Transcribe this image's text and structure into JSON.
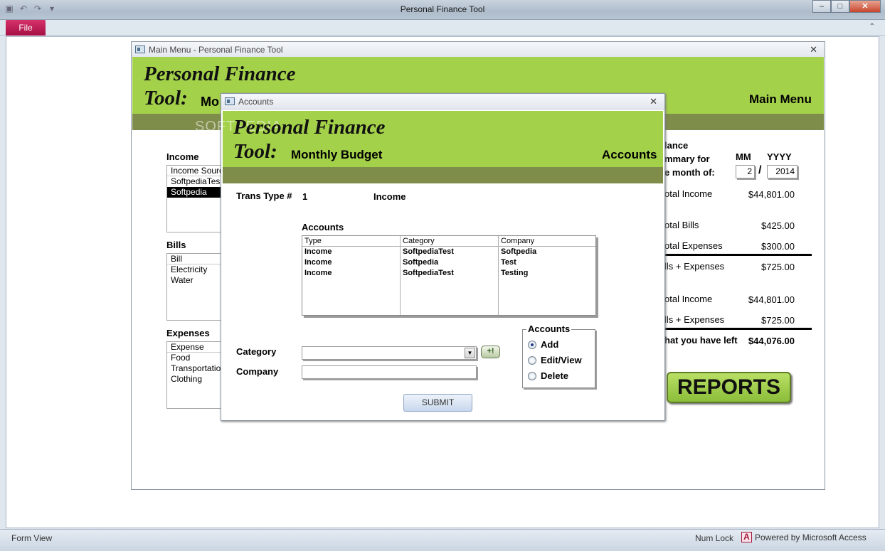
{
  "app": {
    "title": "Personal Finance Tool",
    "file_tab": "File",
    "watermark": "SOFTPEDIA"
  },
  "main_form": {
    "window_title": "Main Menu - Personal Finance Tool",
    "banner_line1": "Personal Finance",
    "banner_line2": "Tool:",
    "banner_subtitle": "Mo",
    "banner_right": "Main Menu",
    "income": {
      "heading": "Income",
      "rows": [
        "Income Sourc",
        "SoftpediaTes",
        "Softpedia"
      ],
      "selected_index": 2
    },
    "bills": {
      "heading": "Bills",
      "rows": [
        "Bill",
        "Electricity",
        "Water"
      ]
    },
    "expenses": {
      "heading": "Expenses",
      "rows": [
        "Expense",
        "Food",
        "Transportatio",
        "Clothing"
      ]
    },
    "summary": {
      "heading_line1": "lance",
      "heading_line2": "mmary for",
      "heading_line3": "e month of:",
      "mm_label": "MM",
      "yyyy_label": "YYYY",
      "mm_value": "2",
      "slash": "/",
      "yyyy_value": "2014",
      "total_income_label": "otal Income",
      "total_income_value": "$44,801.00",
      "total_bills_label": "otal Bills",
      "total_bills_value": "$425.00",
      "total_expenses_label": "otal Expenses",
      "total_expenses_value": "$300.00",
      "bills_expenses_label": "lls + Expenses",
      "bills_expenses_value": "$725.00",
      "total_income_label2": "otal Income",
      "total_income_value2": "$44,801.00",
      "bills_expenses_label2": "lls + Expenses",
      "bills_expenses_value2": "$725.00",
      "left_label": "hat you have left",
      "left_value": "$44,076.00"
    },
    "reports_label": "REPORTS"
  },
  "accounts_form": {
    "window_title": "Accounts",
    "banner_line1": "Personal Finance",
    "banner_line2": "Tool:",
    "banner_subtitle": "Monthly Budget",
    "banner_right": "Accounts",
    "trans_type_label": "Trans Type #",
    "trans_type_value": "1",
    "trans_type_name": "Income",
    "accounts_heading": "Accounts",
    "table": {
      "headers": [
        "Type",
        "Category",
        "Company"
      ],
      "rows": [
        [
          "Income",
          "SoftpediaTest",
          "Softpedia"
        ],
        [
          "Income",
          "Softpedia",
          "Test"
        ],
        [
          "Income",
          "SoftpediaTest",
          "Testing"
        ]
      ]
    },
    "category_label": "Category",
    "category_value": "",
    "company_label": "Company",
    "company_value": "",
    "add_category_glyph": "+!",
    "radio_group": {
      "legend": "Accounts",
      "options": [
        "Add",
        "Edit/View",
        "Delete"
      ],
      "selected": "Add"
    },
    "submit_label": "SUBMIT"
  },
  "status": {
    "form_view": "Form View",
    "num_lock": "Num Lock",
    "access_icon_glyph": "A",
    "powered_by": "Powered by Microsoft Access"
  },
  "colors": {
    "banner_green": "#a4d14a",
    "banner_stripe": "#7f8d4a",
    "file_tab": "#c21d57",
    "reports_button": "#9acb48"
  }
}
